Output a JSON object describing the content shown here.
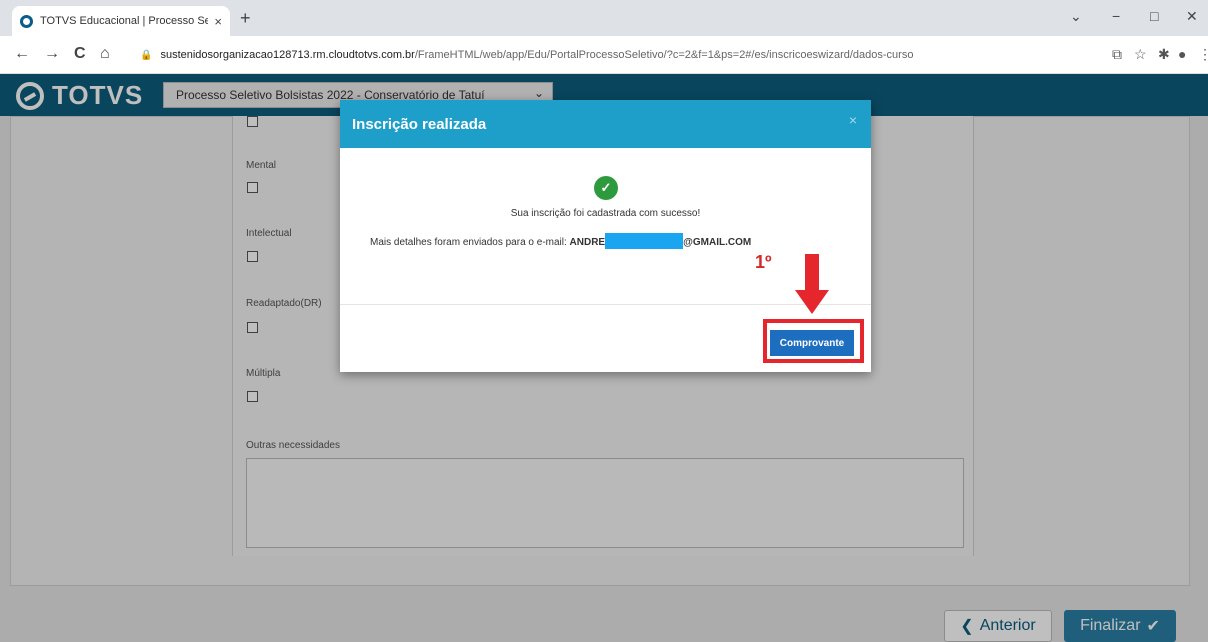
{
  "browser": {
    "tab_title": "TOTVS Educacional | Processo Se",
    "tab_close": "×",
    "new_tab": "+",
    "url_host": "sustenidosorganizacao128713.rm.cloudtotvs.com.br",
    "url_path": "/FrameHTML/web/app/Edu/PortalProcessoSeletivo/?c=2&f=1&ps=2#/es/inscricoeswizard/dados-curso",
    "back": "←",
    "forward": "→",
    "reload": "C",
    "home": "⌂",
    "minimize": "−",
    "maximize": "□",
    "close": "✕",
    "dropdown": "⌄"
  },
  "app": {
    "logo_text": "TOTVS",
    "process_select": "Processo Seletivo Bolsistas 2022 - Conservatório de Tatuí"
  },
  "form": {
    "fields": [
      {
        "label": "Mental"
      },
      {
        "label": "Intelectual"
      },
      {
        "label": "Readaptado(DR)"
      },
      {
        "label": "Múltipla"
      }
    ],
    "textarea_label": "Outras necessidades"
  },
  "footer": {
    "prev_label": "Anterior",
    "prev_icon": "❮",
    "finish_label": "Finalizar",
    "finish_icon": "✔"
  },
  "modal": {
    "title": "Inscrição realizada",
    "close": "×",
    "success_icon": "✓",
    "message": "Sua inscrição foi cadastrada com sucesso!",
    "email_prefix": "Mais detalhes foram enviados para o e-mail:",
    "email_start": "ANDRE",
    "email_end": "@GMAIL.COM",
    "button_label": "Comprovante"
  },
  "annotation": {
    "step_label": "1º",
    "color": "#e5272d"
  }
}
